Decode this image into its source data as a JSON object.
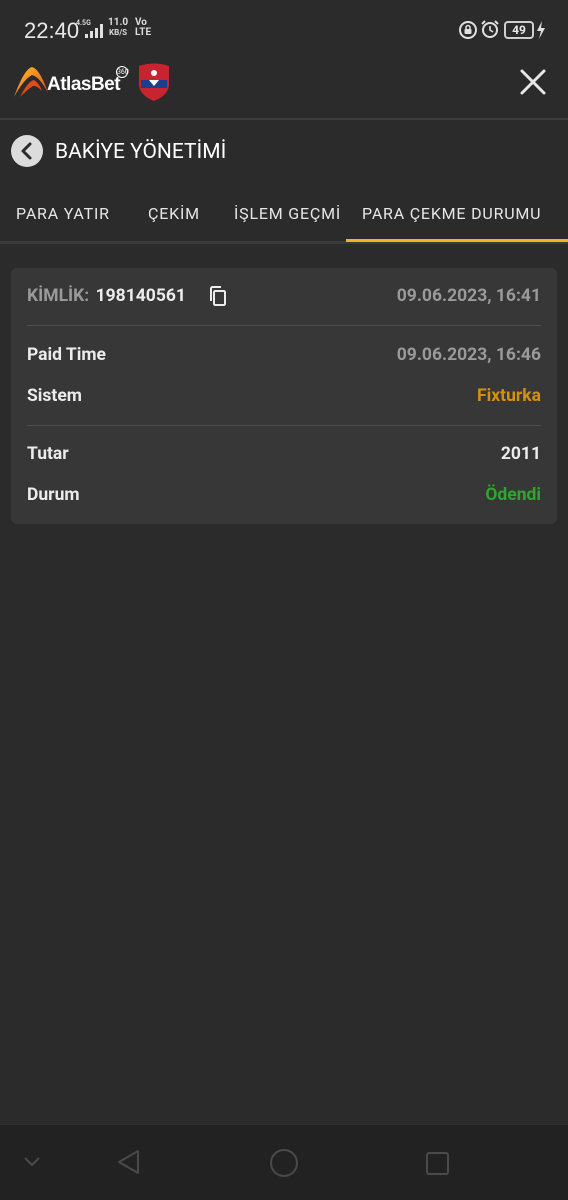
{
  "status_bar": {
    "time": "22:40",
    "network_gen": "4.5G",
    "net_speed_value": "11.0",
    "net_speed_unit": "KB/S",
    "volte_top": "Vo",
    "volte_bottom": "LTE",
    "battery": "49"
  },
  "header": {
    "brand": "AtlasBet",
    "brand_badge": "360"
  },
  "subheader": {
    "title": "BAKİYE YÖNETİMİ"
  },
  "tabs": [
    {
      "label": "PARA YATIR",
      "active": false
    },
    {
      "label": "ÇEKİM",
      "active": false
    },
    {
      "label": "İŞLEM GEÇMİ",
      "active": false
    },
    {
      "label": "PARA ÇEKME DURUMU",
      "active": true
    }
  ],
  "withdrawal": {
    "id_label": "KİMLİK:",
    "id_value": "198140561",
    "created": "09.06.2023, 16:41",
    "paid_time_label": "Paid Time",
    "paid_time_value": "09.06.2023, 16:46",
    "system_label": "Sistem",
    "system_value": "Fixturka",
    "amount_label": "Tutar",
    "amount_value": "2011",
    "status_label": "Durum",
    "status_value": "Ödendi"
  },
  "colors": {
    "accent": "#f2b51e",
    "system": "#d4910f",
    "status_paid": "#2da62d",
    "background": "#2b2b2b",
    "card": "#373737"
  },
  "icons": {
    "back": "chevron-left-icon",
    "close": "close-icon",
    "copy": "copy-icon"
  }
}
